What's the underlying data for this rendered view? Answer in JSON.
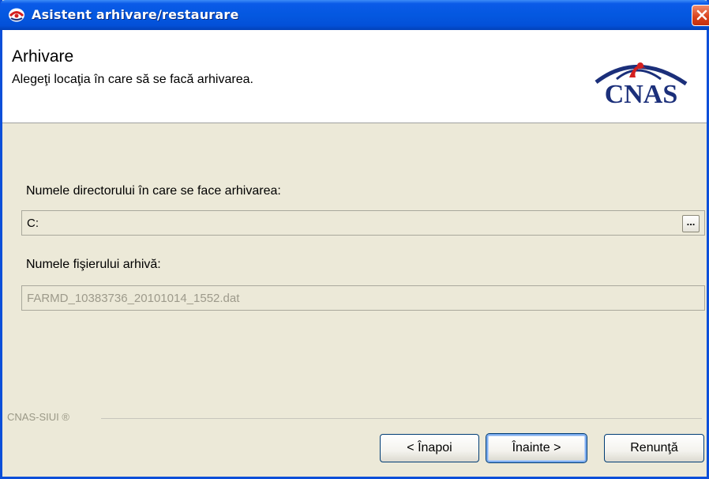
{
  "window": {
    "title": "Asistent arhivare/restaurare",
    "icons": {
      "app": "cnas-app-icon",
      "close": "close-icon"
    }
  },
  "header": {
    "title": "Arhivare",
    "subtitle": "Alegeţi locaţia în care să se facă arhivarea.",
    "logo_text": "CNAS",
    "logo_colors": {
      "text": "#1b2f7a",
      "arc": "#1b2f7a",
      "figure": "#d42020"
    }
  },
  "form": {
    "directory_label": "Numele directorului în care se face arhivarea:",
    "directory_value": "C:",
    "browse_label": "...",
    "file_label": "Numele fişierului arhivă:",
    "file_value": "FARMD_10383736_20101014_1552.dat"
  },
  "footer": {
    "group_label": "CNAS-SIUI ®",
    "buttons": {
      "back": "< Înapoi",
      "next": "Înainte >",
      "cancel": "Renunţă"
    }
  },
  "colors": {
    "titlebar": "#0458e0",
    "window_bg": "#ece9d8",
    "close": "#d8401a"
  }
}
